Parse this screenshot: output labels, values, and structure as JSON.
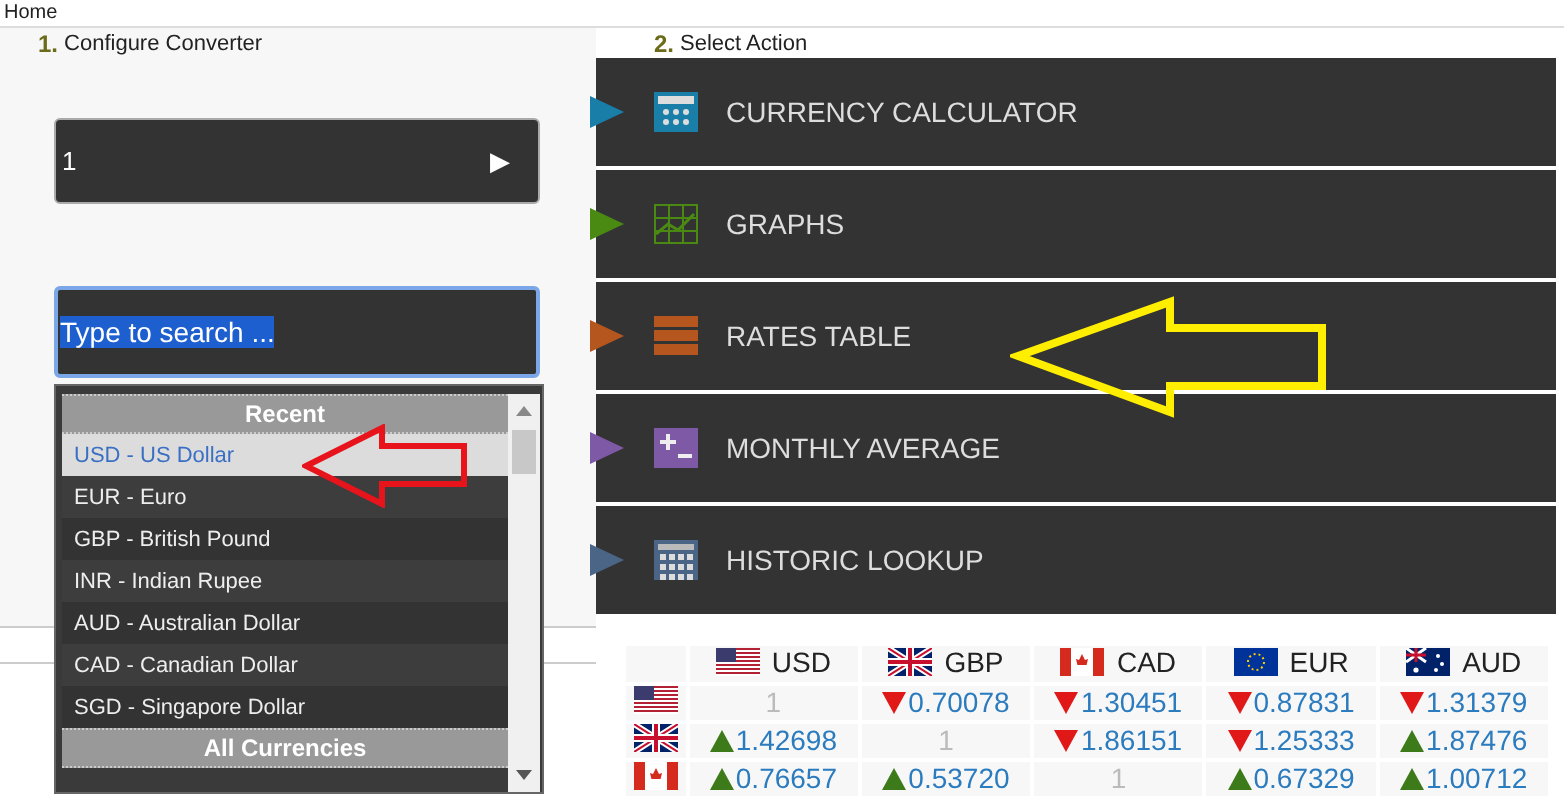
{
  "header": {
    "breadcrumb": "Home"
  },
  "converter": {
    "step": "1.",
    "title": "Configure Converter",
    "amount": "1",
    "play_button": "▶",
    "search": {
      "value": "Type to search ..."
    },
    "dropdown": {
      "groups": [
        {
          "title": "Recent",
          "items": [
            {
              "label": "USD - US Dollar",
              "selected": true
            },
            {
              "label": "EUR - Euro",
              "selected": false
            },
            {
              "label": "GBP - British Pound",
              "selected": false
            },
            {
              "label": "INR - Indian Rupee",
              "selected": false
            },
            {
              "label": "AUD - Australian Dollar",
              "selected": false
            },
            {
              "label": "CAD - Canadian Dollar",
              "selected": false
            },
            {
              "label": "SGD - Singapore Dollar",
              "selected": false
            }
          ]
        },
        {
          "title": "All Currencies"
        }
      ]
    }
  },
  "actions": {
    "step": "2.",
    "title": "Select Action",
    "items": [
      {
        "label": "CURRENCY CALCULATOR",
        "kind": "calculator",
        "color": "#1a7fa8"
      },
      {
        "label": "GRAPHS",
        "kind": "graph",
        "color": "#4a8a12"
      },
      {
        "label": "RATES TABLE",
        "kind": "table",
        "color": "#b5561f"
      },
      {
        "label": "MONTHLY AVERAGE",
        "kind": "average",
        "color": "#7e5aa6"
      },
      {
        "label": "HISTORIC LOOKUP",
        "kind": "calendar",
        "color": "#4a6585"
      }
    ]
  },
  "rates_table": {
    "columns": [
      {
        "label": "USD",
        "kind": "us"
      },
      {
        "label": "GBP",
        "kind": "gb"
      },
      {
        "label": "CAD",
        "kind": "ca"
      },
      {
        "label": "EUR",
        "kind": "eu"
      },
      {
        "label": "AUD",
        "kind": "au"
      }
    ],
    "rows": [
      {
        "kind": "us",
        "cells": [
          {
            "value": "1",
            "kind": "none"
          },
          {
            "value": "0.70078",
            "kind": "down"
          },
          {
            "value": "1.30451",
            "kind": "down"
          },
          {
            "value": "0.87831",
            "kind": "down"
          },
          {
            "value": "1.31379",
            "kind": "down"
          }
        ]
      },
      {
        "kind": "gb",
        "cells": [
          {
            "value": "1.42698",
            "kind": "up"
          },
          {
            "value": "1",
            "kind": "none"
          },
          {
            "value": "1.86151",
            "kind": "down"
          },
          {
            "value": "1.25333",
            "kind": "down"
          },
          {
            "value": "1.87476",
            "kind": "up"
          }
        ]
      },
      {
        "kind": "ca",
        "cells": [
          {
            "value": "0.76657",
            "kind": "up"
          },
          {
            "value": "0.53720",
            "kind": "up"
          },
          {
            "value": "1",
            "kind": "none"
          },
          {
            "value": "0.67329",
            "kind": "up"
          },
          {
            "value": "1.00712",
            "kind": "up"
          }
        ]
      }
    ]
  }
}
